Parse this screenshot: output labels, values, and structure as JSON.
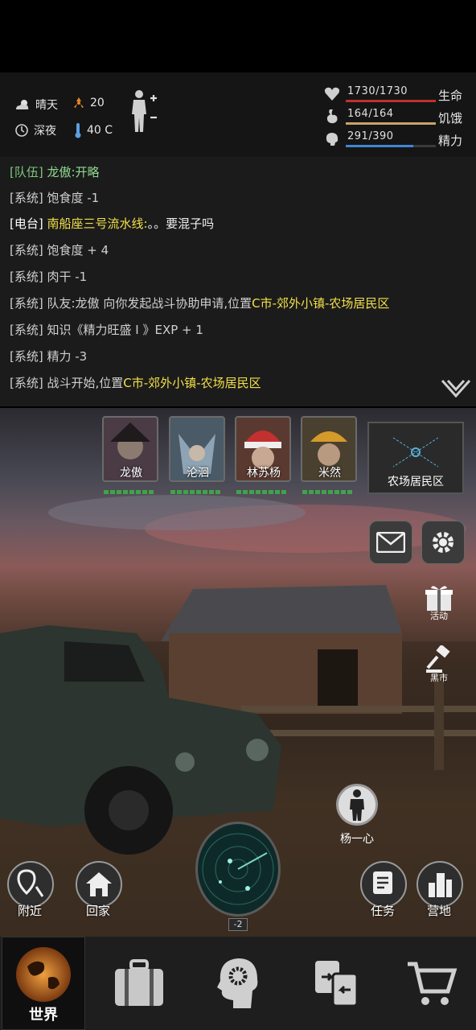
{
  "status": {
    "weather": "晴天",
    "radiation": "20",
    "time_of_day": "深夜",
    "temperature": "40 C",
    "health": {
      "value": "1730/1730",
      "label": "生命",
      "fraction": 1.0,
      "color": "#c0302c"
    },
    "hunger": {
      "value": "164/164",
      "label": "饥饿",
      "fraction": 1.0,
      "color": "#c9a26a"
    },
    "energy": {
      "value": "291/390",
      "label": "精力",
      "fraction": 0.746,
      "color": "#3f86d6"
    }
  },
  "log": [
    {
      "tag": "[队伍]",
      "text": "龙傲:开略",
      "kind": "team"
    },
    {
      "tag": "[系统]",
      "text": "饱食度 -1",
      "kind": "system"
    },
    {
      "tag": "[电台]",
      "name": "南船座三号流水线:",
      "text": "。。要混子吗",
      "kind": "radio"
    },
    {
      "tag": "[系统]",
      "text": "饱食度 + 4",
      "kind": "system"
    },
    {
      "tag": "[系统]",
      "text": "肉干 -1",
      "kind": "system"
    },
    {
      "tag": "[系统]",
      "text": "队友:龙傲 向你发起战斗协助申请,位置",
      "loc": "C市-郊外小镇-农场居民区",
      "kind": "system"
    },
    {
      "tag": "[系统]",
      "text": "知识《精力旺盛 I 》EXP + 1",
      "kind": "system"
    },
    {
      "tag": "[系统]",
      "text": "精力 -3",
      "kind": "system"
    },
    {
      "tag": "[系统]",
      "text": "战斗开始,位置",
      "loc": "C市-郊外小镇-农场居民区",
      "kind": "system"
    }
  ],
  "party": [
    {
      "name": "龙傲"
    },
    {
      "name": "沦洄"
    },
    {
      "name": "林苏杨"
    },
    {
      "name": "米然"
    }
  ],
  "minimap": {
    "label": "农场居民区"
  },
  "side_buttons": {
    "event": "活动",
    "black_market": "黑市"
  },
  "player": {
    "name": "杨一心"
  },
  "actions": {
    "nearby": "附近",
    "home": "回家",
    "quest": "任务",
    "camp": "营地"
  },
  "radar": {
    "level": "-2"
  },
  "nav": {
    "world": "世界"
  }
}
